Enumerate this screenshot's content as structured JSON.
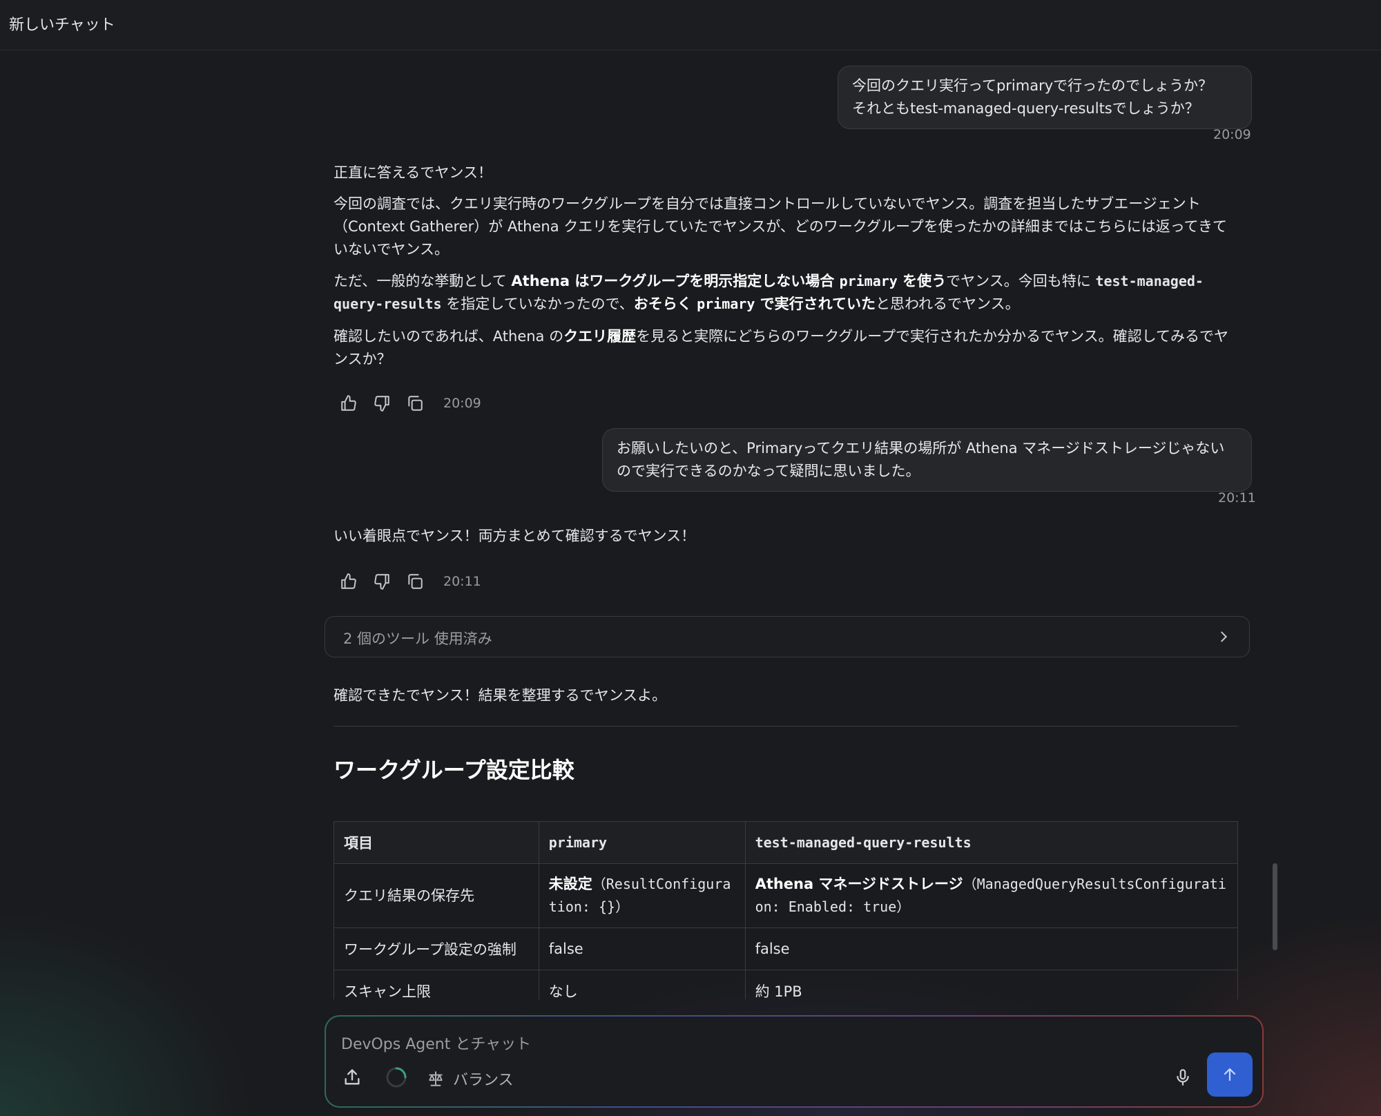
{
  "header": {
    "title": "新しいチャット"
  },
  "messages": {
    "user1": {
      "line1": "今回のクエリ実行ってprimaryで行ったのでしょうか？",
      "line2": "それともtest-managed-query-resultsでしょうか？",
      "time": "20:09"
    },
    "bot1": {
      "p1": "正直に答えるでヤンス！",
      "p2": "今回の調査では、クエリ実行時のワークグループを自分では直接コントロールしていないでヤンス。調査を担当したサブエージェント（Context Gatherer）が Athena クエリを実行していたでヤンスが、どのワークグループを使ったかの詳細まではこちらには返ってきていないでヤンス。",
      "p3_a": "ただ、一般的な挙動として ",
      "p3_b": "Athena はワークグループを明示指定しない場合 ",
      "p3_c": "primary",
      "p3_d": " を使う",
      "p3_e": "でヤンス。今回も特に ",
      "p3_f": "test-managed-query-results",
      "p3_g": " を指定していなかったので、",
      "p3_h": "おそらく ",
      "p3_i": "primary",
      "p3_j": " で実行されていた",
      "p3_k": "と思われるでヤンス。",
      "p4_a": "確認したいのであれば、Athena の",
      "p4_b": "クエリ履歴",
      "p4_c": "を見ると実際にどちらのワークグループで実行されたか分かるでヤンス。確認してみるでヤンスか？",
      "time": "20:09"
    },
    "user2": {
      "text": "お願いしたいのと、Primaryってクエリ結果の場所が Athena マネージドストレージじゃないので実行できるのかなって疑問に思いました。",
      "time": "20:11"
    },
    "bot2": {
      "text": "いい着眼点でヤンス！両方まとめて確認するでヤンス！",
      "time": "20:11"
    },
    "tools": {
      "label": "2 個のツール 使用済み"
    },
    "bot3": {
      "text": "確認できたでヤンス！結果を整理するでヤンスよ。",
      "heading": "ワークグループ設定比較",
      "table": {
        "headers": [
          "項目",
          "primary",
          "test-managed-query-results"
        ],
        "rows": [
          {
            "item": "クエリ結果の保存先",
            "primary_bold": "未設定",
            "primary_rest": "（ResultConfiguration: {}）",
            "managed_bold": "Athena マネージドストレージ",
            "managed_rest": "（ManagedQueryResultsConfiguration: Enabled: true）"
          },
          {
            "item": "ワークグループ設定の強制",
            "primary": "false",
            "managed": "false"
          },
          {
            "item": "スキャン上限",
            "primary": "なし",
            "managed": "約 1PB"
          }
        ]
      }
    }
  },
  "composer": {
    "placeholder": "DevOps Agent とチャット",
    "mode_label": "バランス"
  },
  "icons": {
    "like": "thumbs-up-icon",
    "dislike": "thumbs-down-icon",
    "copy": "copy-icon",
    "chevron": "chevron-right-icon",
    "upload": "upload-icon",
    "spinner": "loading-spinner-icon",
    "scale": "scale-icon",
    "mic": "microphone-icon",
    "send": "arrow-up-icon"
  },
  "colors": {
    "send_button": "#2f5fd0",
    "background": "#1a1b1e"
  }
}
